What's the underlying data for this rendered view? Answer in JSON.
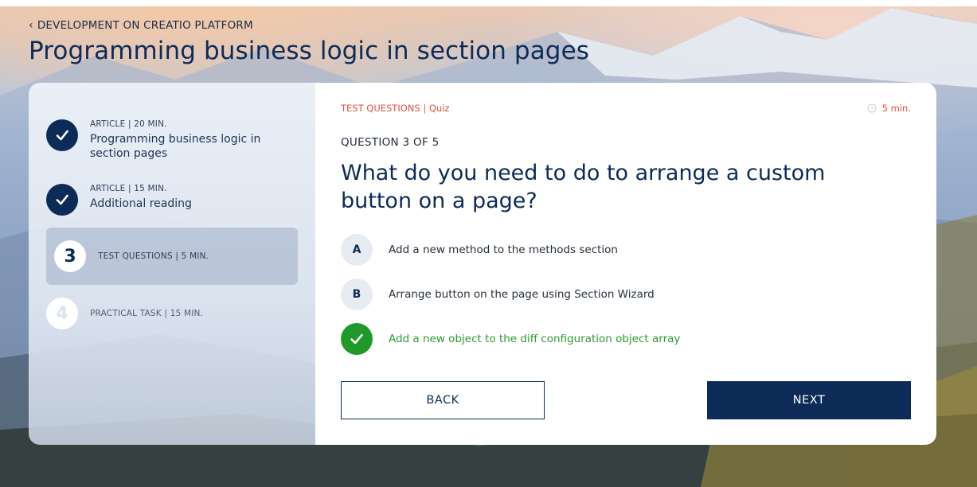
{
  "breadcrumb": {
    "label": "DEVELOPMENT ON CREATIO PLATFORM",
    "icon": "chevron-left-icon"
  },
  "page_title": "Programming business logic in section pages",
  "steps": [
    {
      "meta": "ARTICLE | 20 MIN.",
      "name": "Programming business logic in section pages",
      "status": "done",
      "number": ""
    },
    {
      "meta": "ARTICLE | 15 MIN.",
      "name": "Additional reading",
      "status": "done",
      "number": ""
    },
    {
      "meta": "TEST QUESTIONS | 5 MIN.",
      "name": "",
      "status": "active",
      "number": "3"
    },
    {
      "meta": "PRACTICAL TASK | 15 MIN.",
      "name": "",
      "status": "locked",
      "number": "4"
    }
  ],
  "quiz": {
    "label": "TEST QUESTIONS | Quiz",
    "duration": "5 min.",
    "question_number": "QUESTION 3 OF 5",
    "question": "What do you need to do to arrange a custom button on a page?",
    "options": [
      {
        "letter": "A",
        "text": "Add a new method to the methods section",
        "correct": false
      },
      {
        "letter": "B",
        "text": "Arrange button on the page using Section Wizard",
        "correct": false
      },
      {
        "letter": "",
        "text": "Add a new object to the diff configuration object array",
        "correct": true
      }
    ]
  },
  "buttons": {
    "back": "BACK",
    "next": "NEXT"
  },
  "colors": {
    "primary": "#0c2b57",
    "accent": "#e0503a",
    "correct": "#1f9a2a"
  }
}
